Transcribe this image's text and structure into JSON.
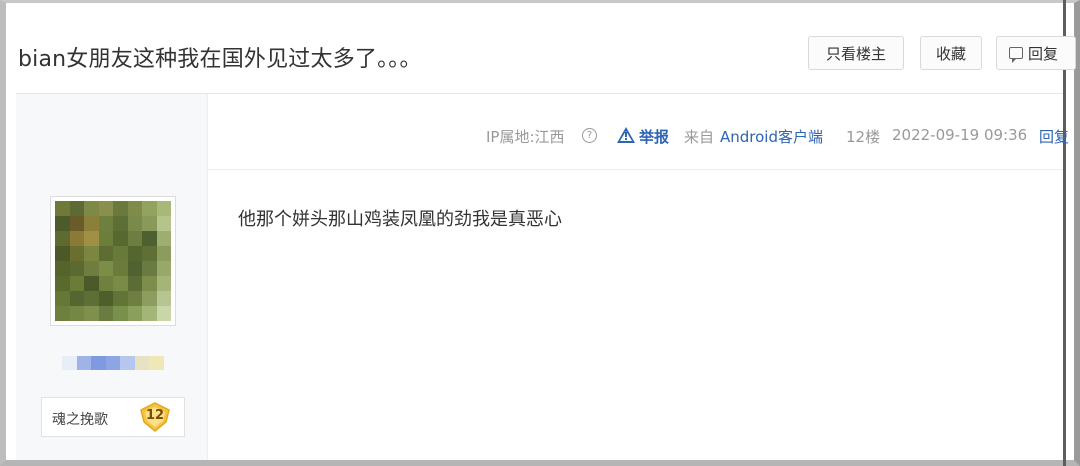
{
  "thread": {
    "title": "bian女朋友这种我在国外见过太多了。。。",
    "buttons": {
      "only_op": "只看楼主",
      "favorite": "收藏",
      "reply": "回复"
    }
  },
  "post": {
    "meta": {
      "ip_location": "IP属地:江西",
      "report": "举报",
      "from_prefix": "来自",
      "client": "Android客户端",
      "floor": "12楼",
      "datetime": "2022-09-19 09:36",
      "reply": "回复"
    },
    "author": {
      "forum_title": "魂之挽歌",
      "level": "12",
      "avatar_pixelated": true,
      "username_pixelated": true
    },
    "content": "他那个姘头那山鸡装凤凰的劲我是真恶心"
  },
  "icons": [
    "question-icon",
    "warning-icon",
    "reply-icon",
    "level-shield-icon"
  ],
  "colors": {
    "link_blue": "#2d64b3",
    "meta_gray": "#999999",
    "level_gold": "#f5c542"
  }
}
